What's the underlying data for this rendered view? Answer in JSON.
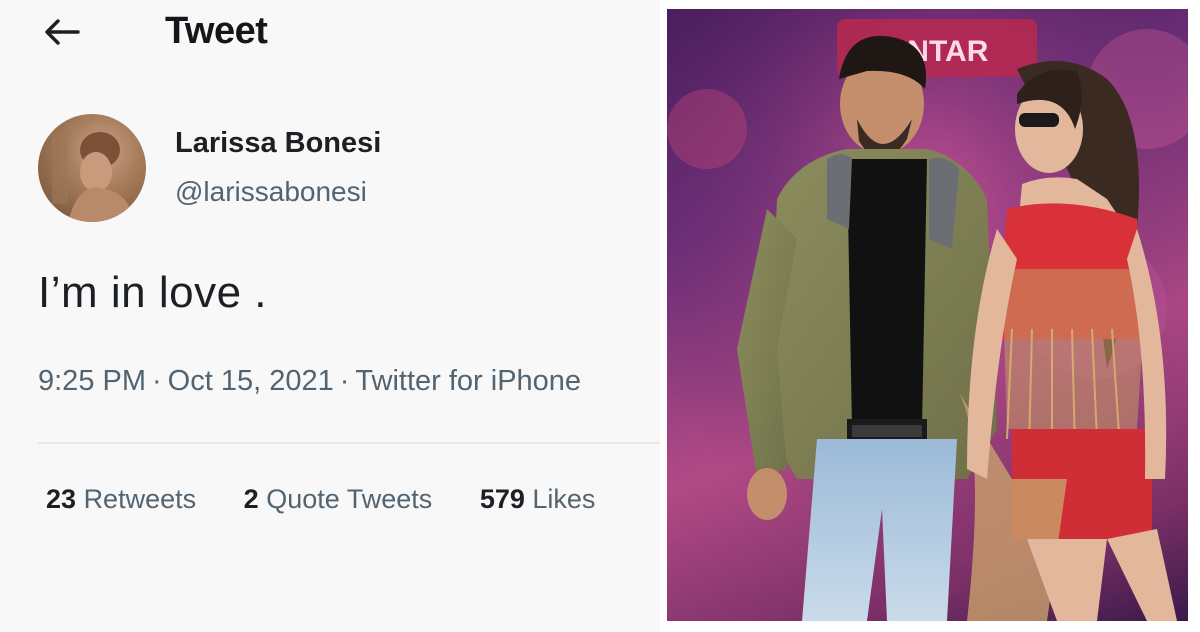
{
  "header": {
    "title": "Tweet",
    "back_icon": "arrow-left-icon"
  },
  "tweet": {
    "author": {
      "name": "Larissa Bonesi",
      "handle": "@larissabonesi"
    },
    "text": "I’m in love .",
    "time": "9:25 PM",
    "date": "Oct 15, 2021",
    "source": "Twitter for iPhone",
    "stats": {
      "retweets": {
        "count": "23",
        "label": "Retweets"
      },
      "quotes": {
        "count": "2",
        "label": "Quote Tweets"
      },
      "likes": {
        "count": "579",
        "label": "Likes"
      }
    }
  },
  "photo": {
    "sign_text": "ANTAR"
  },
  "colors": {
    "text_primary": "#1c1f23",
    "text_secondary": "#536471",
    "panel_background": "#f8f8f9"
  }
}
